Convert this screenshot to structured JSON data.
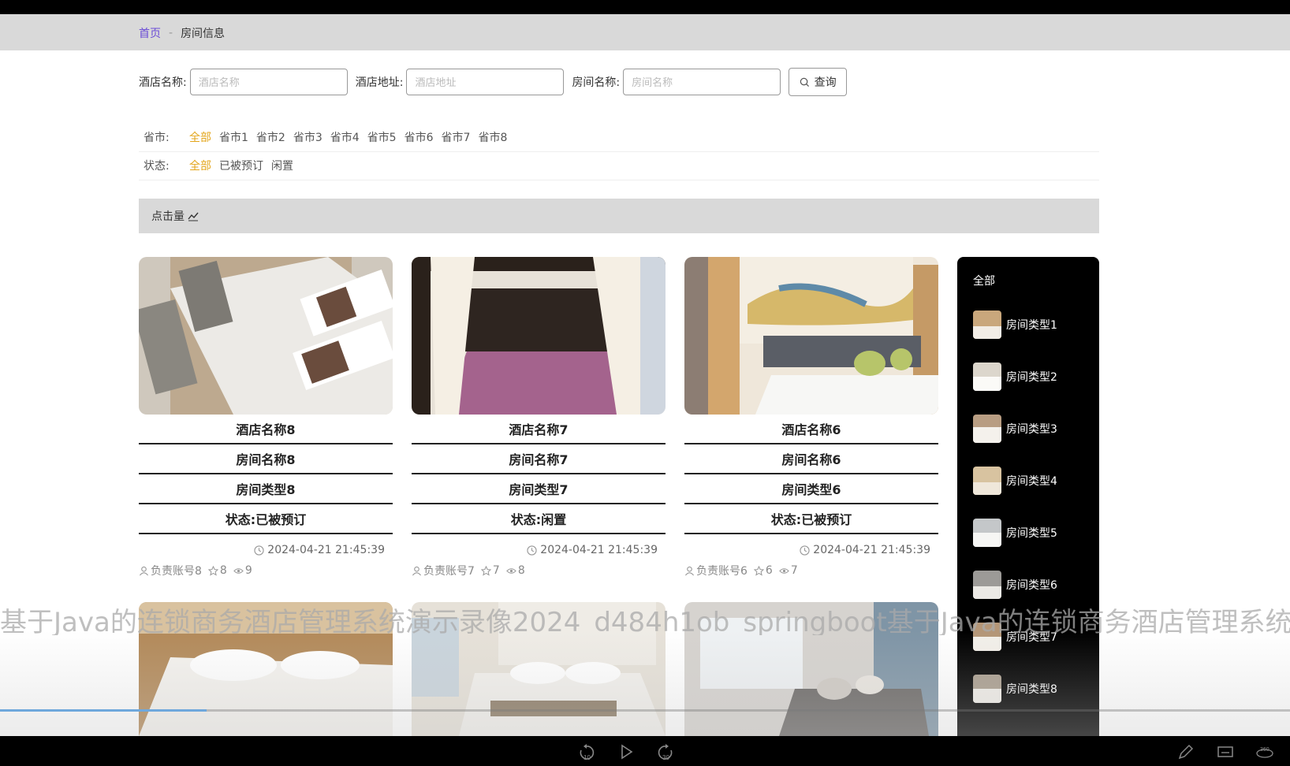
{
  "breadcrumb": {
    "home": "首页",
    "separator": "-",
    "current": "房间信息"
  },
  "search": {
    "hotel_name_label": "酒店名称:",
    "hotel_name_placeholder": "酒店名称",
    "hotel_address_label": "酒店地址:",
    "hotel_address_placeholder": "酒店地址",
    "room_name_label": "房间名称:",
    "room_name_placeholder": "房间名称",
    "search_button": "查询"
  },
  "filters": {
    "province": {
      "label": "省市:",
      "options": [
        "全部",
        "省市1",
        "省市2",
        "省市3",
        "省市4",
        "省市5",
        "省市6",
        "省市7",
        "省市8"
      ],
      "active": "全部"
    },
    "status": {
      "label": "状态:",
      "options": [
        "全部",
        "已被预订",
        "闲置"
      ],
      "active": "全部"
    }
  },
  "sort": {
    "label": "点击量"
  },
  "cards": [
    {
      "hotel": "酒店名称8",
      "room": "房间名称8",
      "type": "房间类型8",
      "status": "状态:已被预订",
      "date": "2024-04-21 21:45:39",
      "account": "负责账号8",
      "stars": "8",
      "views": "9"
    },
    {
      "hotel": "酒店名称7",
      "room": "房间名称7",
      "type": "房间类型7",
      "status": "状态:闲置",
      "date": "2024-04-21 21:45:39",
      "account": "负责账号7",
      "stars": "7",
      "views": "8"
    },
    {
      "hotel": "酒店名称6",
      "room": "房间名称6",
      "type": "房间类型6",
      "status": "状态:已被预订",
      "date": "2024-04-21 21:45:39",
      "account": "负责账号6",
      "stars": "6",
      "views": "7"
    }
  ],
  "sidebar": {
    "all_label": "全部",
    "items": [
      "房间类型1",
      "房间类型2",
      "房间类型3",
      "房间类型4",
      "房间类型5",
      "房间类型6",
      "房间类型7",
      "房间类型8"
    ]
  },
  "watermark": "基于Java的连锁商务酒店管理系统演示录像2024_d484h1ob_springboot基于Java的连锁商务酒店管理系统演示录像",
  "player": {
    "progress": 0.16
  },
  "colors": {
    "accent": "#e3a61c",
    "link": "#6a4bd6",
    "sidebar_bg": "#000000"
  }
}
